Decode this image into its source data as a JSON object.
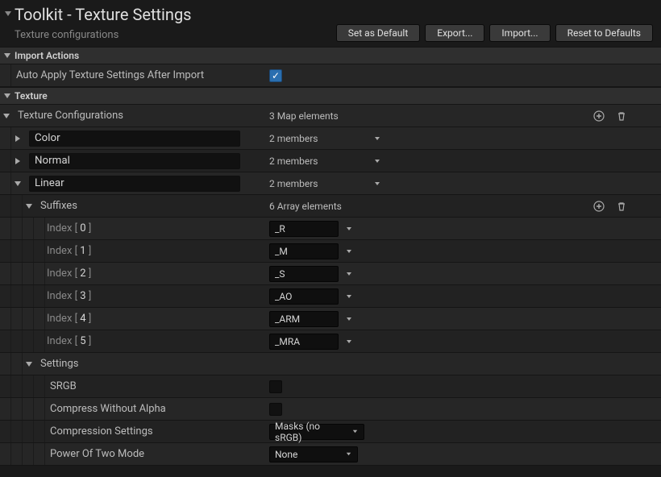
{
  "header": {
    "title": "Toolkit - Texture Settings",
    "subtitle": "Texture configurations",
    "buttons": {
      "set_default": "Set as Default",
      "export": "Export...",
      "import": "Import...",
      "reset": "Reset to Defaults"
    }
  },
  "sections": {
    "import_actions": {
      "label": "Import Actions"
    },
    "texture": {
      "label": "Texture"
    }
  },
  "import_actions": {
    "auto_apply": {
      "label": "Auto Apply Texture Settings After Import",
      "checked": true
    }
  },
  "texture_configurations": {
    "label": "Texture Configurations",
    "count_text": "3 Map elements",
    "entries": {
      "color": {
        "name": "Color",
        "members_text": "2 members"
      },
      "normal": {
        "name": "Normal",
        "members_text": "2 members"
      },
      "linear": {
        "name": "Linear",
        "members_text": "2 members"
      }
    }
  },
  "linear": {
    "suffixes": {
      "label": "Suffixes",
      "count_text": "6 Array elements",
      "index_word": "Index",
      "items": [
        {
          "idx": "0",
          "value": "_R"
        },
        {
          "idx": "1",
          "value": "_M"
        },
        {
          "idx": "2",
          "value": "_S"
        },
        {
          "idx": "3",
          "value": "_AO"
        },
        {
          "idx": "4",
          "value": "_ARM"
        },
        {
          "idx": "5",
          "value": "_MRA"
        }
      ]
    },
    "settings": {
      "label": "Settings",
      "srgb": {
        "label": "SRGB",
        "checked": false
      },
      "cwa": {
        "label": "Compress Without Alpha",
        "checked": false
      },
      "cset": {
        "label": "Compression Settings",
        "value": "Masks (no sRGB)"
      },
      "pot": {
        "label": "Power Of Two Mode",
        "value": "None"
      }
    }
  }
}
